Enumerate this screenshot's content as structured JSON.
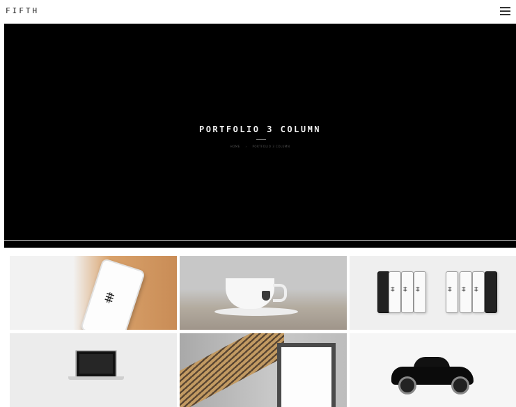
{
  "header": {
    "logo": "FIFTH",
    "menu_icon": "hamburger-icon"
  },
  "hero": {
    "title": "PORTFOLIO 3 COLUMN",
    "breadcrumb": [
      {
        "label": "HOME"
      },
      {
        "label": "PORTFOLIO 3 COLUMN"
      }
    ],
    "separator": "›"
  },
  "portfolio": {
    "items": [
      {
        "glyph": "⩨"
      },
      {
        "glyph": ""
      },
      {
        "glyph": "⩨"
      },
      {
        "glyph": ""
      },
      {
        "glyph": ""
      },
      {
        "glyph": ""
      }
    ]
  },
  "colors": {
    "hero_bg": "#000000",
    "page_bg": "#ffffff",
    "text_light": "#f0f0f0"
  }
}
